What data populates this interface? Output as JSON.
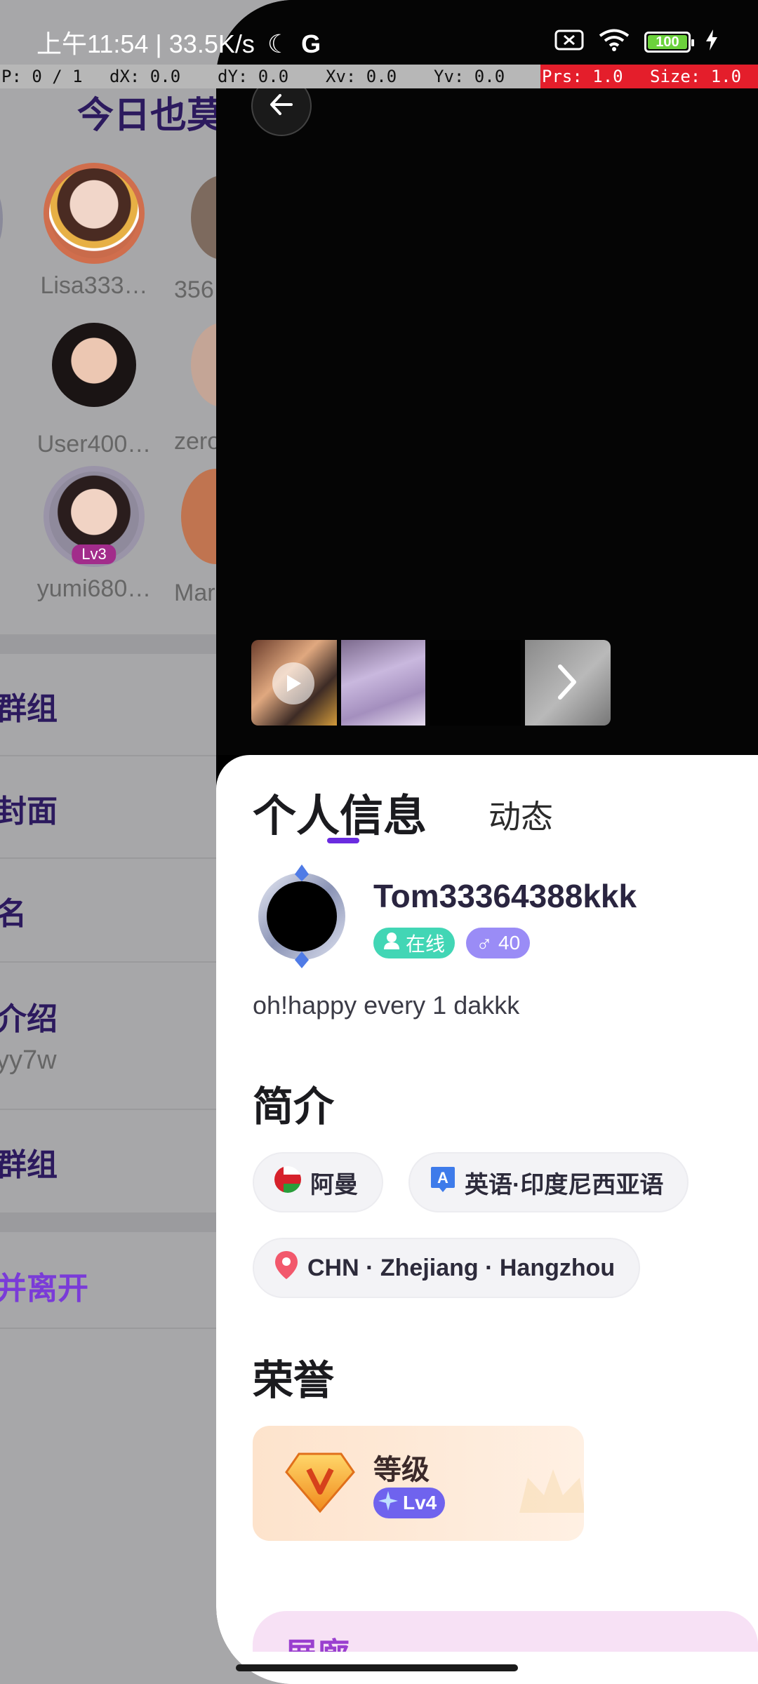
{
  "status_bar": {
    "time": "上午11:54 | 33.5K/s",
    "battery": "100"
  },
  "pointer_bar": [
    "P: 0 / 1",
    "dX: 0.0",
    "dY: 0.0",
    "Xv: 0.0",
    "Yv: 0.0",
    "Prs: 1.0",
    "Size: 1.0"
  ],
  "background": {
    "title": "今日也莫",
    "members": [
      {
        "name": "Lisa333…",
        "level": ""
      },
      {
        "name": "User400…",
        "level": ""
      },
      {
        "name": "yumi680…",
        "level": "Lv3"
      }
    ],
    "partial_members": [
      "356",
      "zero",
      "Mar"
    ],
    "rows": [
      {
        "label": "群组",
        "sub": ""
      },
      {
        "label": "封面",
        "sub": ""
      },
      {
        "label": "名",
        "sub": ""
      },
      {
        "label": "介绍",
        "sub": "yy7w"
      },
      {
        "label": "群组",
        "sub": ""
      }
    ],
    "leave": "并离开"
  },
  "drawer": {
    "back_icon": "arrow-left-icon",
    "thumbnails": [
      "video",
      "photo",
      "photo",
      "more"
    ],
    "tabs": {
      "active": "个人信息",
      "inactive": "动态"
    },
    "profile": {
      "username": "Tom33364388kkk",
      "status": "在线",
      "gender_symbol": "♂",
      "age": "40",
      "bio": "oh!happy every 1 dakkk"
    },
    "intro": {
      "title": "简介",
      "country": "阿曼",
      "languages": "英语·印度尼西亚语",
      "location": "CHN · Zhejiang · Hangzhou"
    },
    "honor": {
      "title": "荣誉",
      "label": "等级",
      "level": "Lv4"
    },
    "gallery_title": "展廊"
  }
}
